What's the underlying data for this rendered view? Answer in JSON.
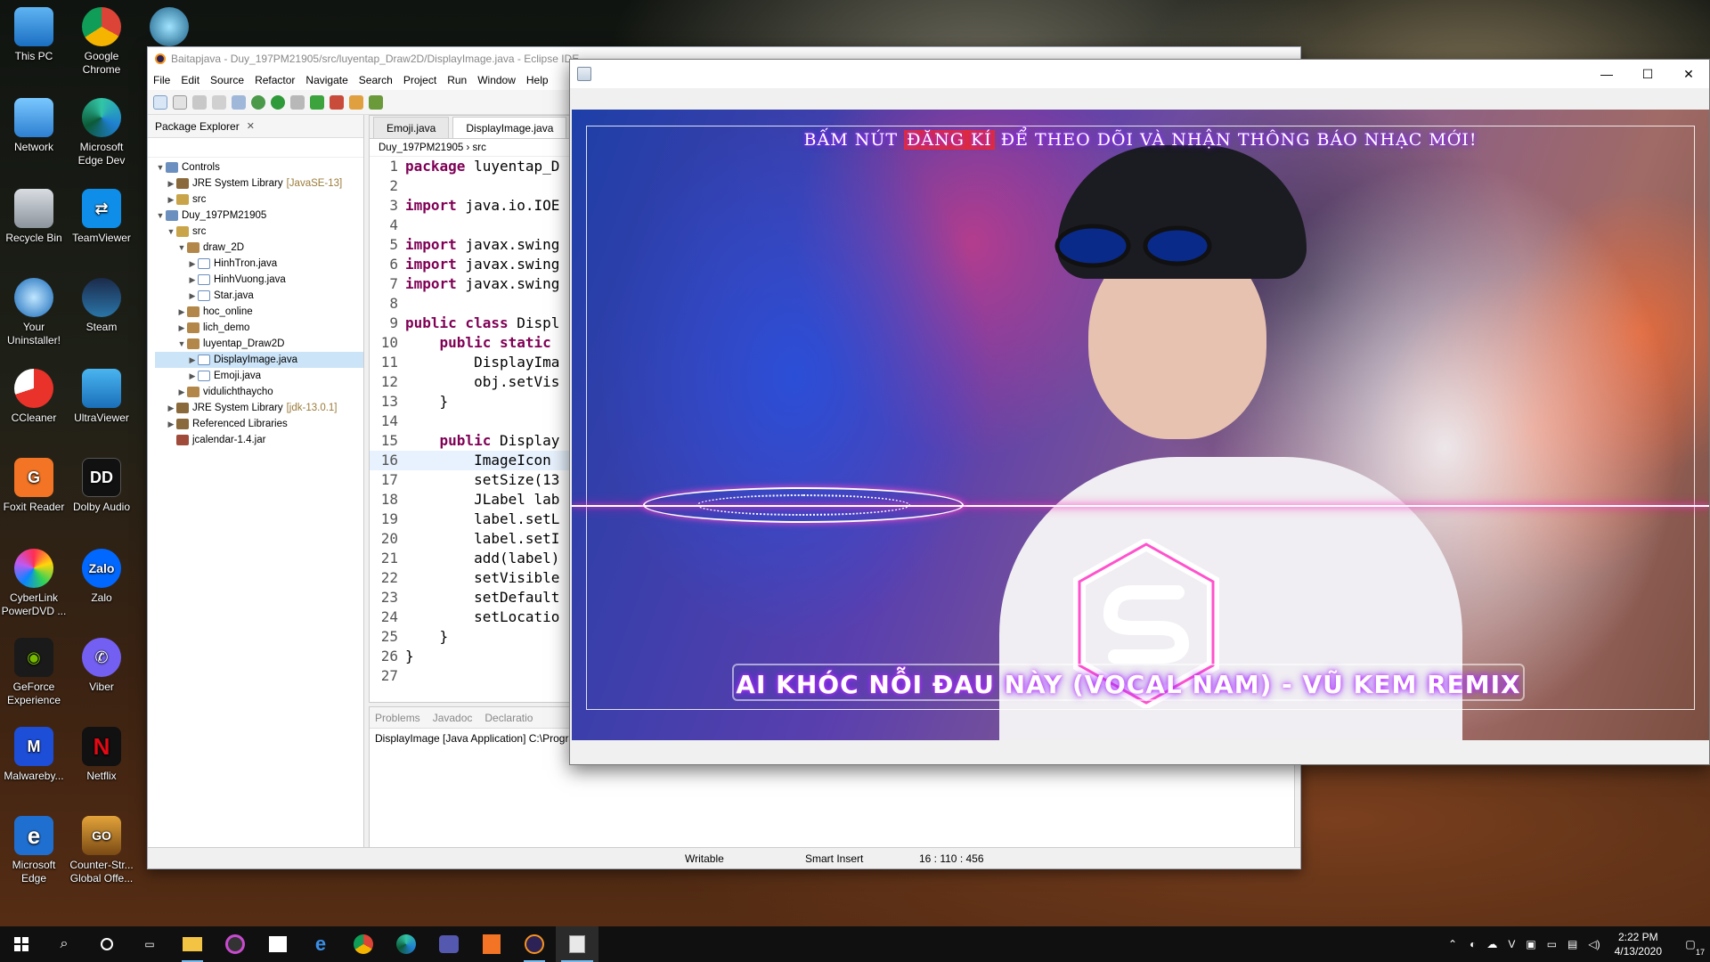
{
  "desktop": {
    "icons": [
      {
        "label": "This PC"
      },
      {
        "label": "Google Chrome"
      },
      {
        "label": "Network"
      },
      {
        "label": "Microsoft Edge Dev"
      },
      {
        "label": "Recycle Bin"
      },
      {
        "label": "TeamViewer"
      },
      {
        "label": "Your Uninstaller!"
      },
      {
        "label": "Steam"
      },
      {
        "label": "CCleaner"
      },
      {
        "label": "UltraViewer"
      },
      {
        "label": "Foxit Reader"
      },
      {
        "label": "Dolby Audio"
      },
      {
        "label": "CyberLink PowerDVD ..."
      },
      {
        "label": "Zalo"
      },
      {
        "label": "GeForce Experience"
      },
      {
        "label": "Viber"
      },
      {
        "label": "Malwareby..."
      },
      {
        "label": "Netflix"
      },
      {
        "label": "Microsoft Edge"
      },
      {
        "label": "Counter-Str... Global Offe..."
      }
    ]
  },
  "eclipse": {
    "title": "Baitapjava - Duy_197PM21905/src/luyentap_Draw2D/DisplayImage.java - Eclipse IDE",
    "menu": [
      "File",
      "Edit",
      "Source",
      "Refactor",
      "Navigate",
      "Search",
      "Project",
      "Run",
      "Window",
      "Help"
    ],
    "package_explorer": {
      "title": "Package Explorer",
      "tree": [
        {
          "label": "Controls"
        },
        {
          "label": "JRE System Library",
          "hint": "[JavaSE-13]"
        },
        {
          "label": "src"
        },
        {
          "label": "Duy_197PM21905"
        },
        {
          "label": "src"
        },
        {
          "label": "draw_2D"
        },
        {
          "label": "HinhTron.java"
        },
        {
          "label": "HinhVuong.java"
        },
        {
          "label": "Star.java"
        },
        {
          "label": "hoc_online"
        },
        {
          "label": "lich_demo"
        },
        {
          "label": "luyentap_Draw2D"
        },
        {
          "label": "DisplayImage.java"
        },
        {
          "label": "Emoji.java"
        },
        {
          "label": "vidulichthaycho"
        },
        {
          "label": "JRE System Library",
          "hint": "[jdk-13.0.1]"
        },
        {
          "label": "Referenced Libraries"
        },
        {
          "label": "jcalendar-1.4.jar"
        }
      ]
    },
    "editor": {
      "tabs": [
        "Emoji.java",
        "DisplayImage.java"
      ],
      "breadcrumb": [
        "Duy_197PM21905",
        "src"
      ],
      "lines": [
        {
          "n": "1",
          "kw": "package",
          "rest": " luyentap_D"
        },
        {
          "n": "2",
          "kw": "",
          "rest": ""
        },
        {
          "n": "3",
          "kw": "import",
          "rest": " java.io.IOE"
        },
        {
          "n": "4",
          "kw": "",
          "rest": ""
        },
        {
          "n": "5",
          "kw": "import",
          "rest": " javax.swing"
        },
        {
          "n": "6",
          "kw": "import",
          "rest": " javax.swing"
        },
        {
          "n": "7",
          "kw": "import",
          "rest": " javax.swing"
        },
        {
          "n": "8",
          "kw": "",
          "rest": ""
        },
        {
          "n": "9",
          "kw": "public class",
          "rest": " Displ"
        },
        {
          "n": "10",
          "kw": "    public static",
          "rest": ""
        },
        {
          "n": "11",
          "kw": "",
          "rest": "        DisplayIma"
        },
        {
          "n": "12",
          "kw": "",
          "rest": "        obj.setVis"
        },
        {
          "n": "13",
          "kw": "",
          "rest": "    }"
        },
        {
          "n": "14",
          "kw": "",
          "rest": ""
        },
        {
          "n": "15",
          "kw": "    public",
          "rest": " Display"
        },
        {
          "n": "16",
          "kw": "",
          "rest": "        ImageIcon"
        },
        {
          "n": "17",
          "kw": "",
          "rest": "        setSize(13"
        },
        {
          "n": "18",
          "kw": "",
          "rest": "        JLabel lab"
        },
        {
          "n": "19",
          "kw": "",
          "rest": "        label.setL"
        },
        {
          "n": "20",
          "kw": "",
          "rest": "        label.setI"
        },
        {
          "n": "21",
          "kw": "",
          "rest": "        add(label)"
        },
        {
          "n": "22",
          "kw": "",
          "rest": "        setVisible"
        },
        {
          "n": "23",
          "kw": "",
          "rest": "        setDefault"
        },
        {
          "n": "24",
          "kw": "",
          "rest": "        setLocatio"
        },
        {
          "n": "25",
          "kw": "",
          "rest": "    }"
        },
        {
          "n": "26",
          "kw": "",
          "rest": "}"
        },
        {
          "n": "27",
          "kw": "",
          "rest": ""
        }
      ]
    },
    "console": {
      "tabs": [
        "Problems",
        "Javadoc",
        "Declaratio"
      ],
      "line": "DisplayImage [Java Application] C:\\Prograi"
    },
    "status": {
      "mode": "Writable",
      "insert": "Smart Insert",
      "position": "16 : 110 : 456"
    }
  },
  "java_window": {
    "banner_text_before": "BẤM NÚT ",
    "banner_highlight": "ĐĂNG KÍ",
    "banner_text_after": " ĐỂ THEO DÕI VÀ NHẬN THÔNG BÁO NHẠC MỚI!",
    "song_title": "AI KHÓC NỖI ĐAU NÀY (VOCAL NAM) - VŨ KEM REMIX",
    "accent": "#e32c38",
    "glow": "#ff3fc8"
  },
  "taskbar": {
    "time": "2:22 PM",
    "date": "4/13/2020",
    "notification_count": "17"
  }
}
